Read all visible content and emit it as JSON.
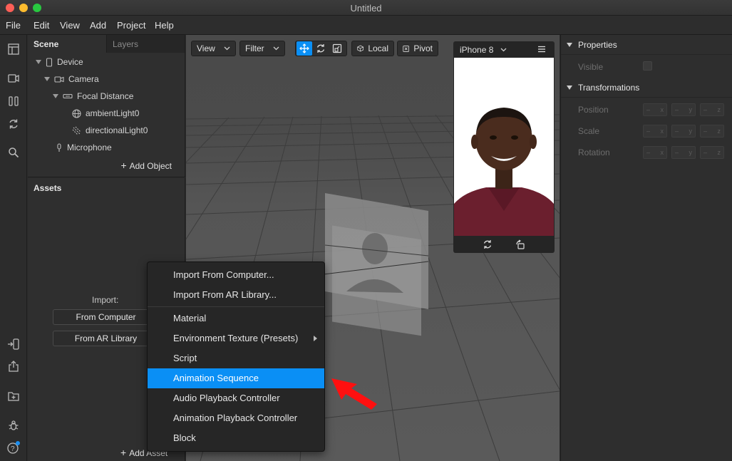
{
  "window": {
    "title": "Untitled"
  },
  "menubar": [
    "File",
    "Edit",
    "View",
    "Add",
    "Project",
    "Help"
  ],
  "scene_panel": {
    "tabs": [
      "Scene",
      "Layers"
    ],
    "tree": [
      {
        "label": "Device",
        "icon": "device-icon"
      },
      {
        "label": "Camera",
        "icon": "camera-icon"
      },
      {
        "label": "Focal Distance",
        "icon": "focal-distance-icon"
      },
      {
        "label": "ambientLight0",
        "icon": "globe-icon"
      },
      {
        "label": "directionalLight0",
        "icon": "directional-light-icon"
      },
      {
        "label": "Microphone",
        "icon": "microphone-icon"
      }
    ],
    "add_object": "Add Object"
  },
  "assets_panel": {
    "title": "Assets",
    "import_label": "Import:",
    "from_computer": "From Computer",
    "from_ar_library": "From AR Library",
    "add_asset": "Add Asset"
  },
  "viewport": {
    "view_label": "View",
    "filter_label": "Filter",
    "local_label": "Local",
    "pivot_label": "Pivot",
    "device_select": "iPhone 8",
    "accent_color": "#0a8ff5"
  },
  "properties": {
    "properties_title": "Properties",
    "visible_label": "Visible",
    "transformations_title": "Transformations",
    "rows": [
      "Position",
      "Scale",
      "Rotation"
    ],
    "axes": [
      "x",
      "y",
      "z"
    ],
    "axis_marker": "–"
  },
  "context_menu": {
    "items_top": [
      "Import From Computer...",
      "Import From AR Library..."
    ],
    "items_bottom": [
      "Material",
      "Environment Texture (Presets)",
      "Script",
      "Animation Sequence",
      "Audio Playback Controller",
      "Animation Playback Controller",
      "Block"
    ],
    "selected": "Animation Sequence",
    "highlight_color": "#0a8ff5"
  },
  "annotation": {
    "arrow_color": "#ff0000"
  }
}
